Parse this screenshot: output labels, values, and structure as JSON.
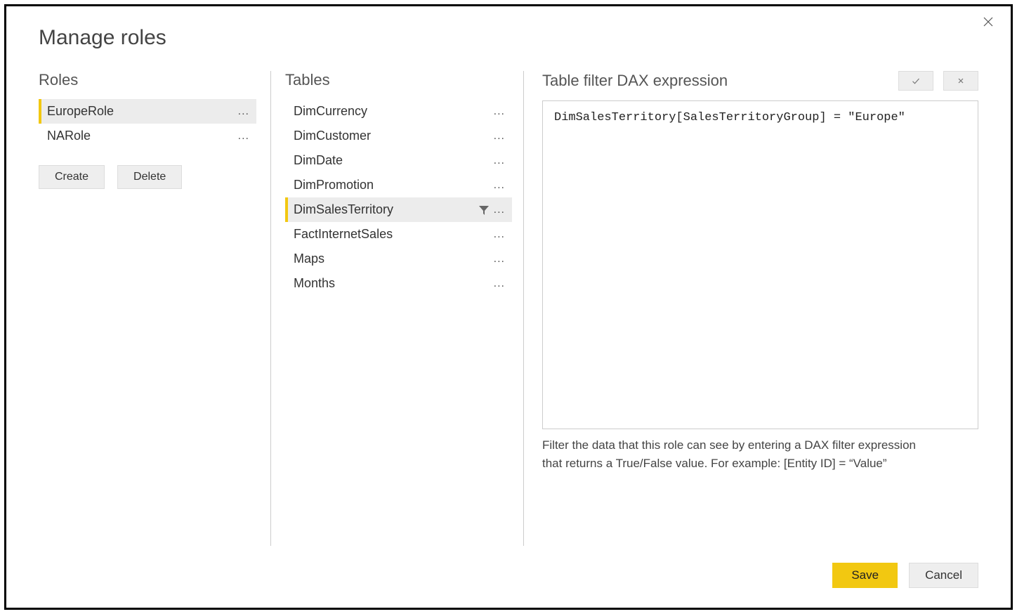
{
  "dialog": {
    "title": "Manage roles"
  },
  "roles": {
    "title": "Roles",
    "items": [
      {
        "name": "EuropeRole",
        "selected": true
      },
      {
        "name": "NARole",
        "selected": false
      }
    ],
    "create_label": "Create",
    "delete_label": "Delete"
  },
  "tables": {
    "title": "Tables",
    "items": [
      {
        "name": "DimCurrency",
        "selected": false,
        "has_filter": false
      },
      {
        "name": "DimCustomer",
        "selected": false,
        "has_filter": false
      },
      {
        "name": "DimDate",
        "selected": false,
        "has_filter": false
      },
      {
        "name": "DimPromotion",
        "selected": false,
        "has_filter": false
      },
      {
        "name": "DimSalesTerritory",
        "selected": true,
        "has_filter": true
      },
      {
        "name": "FactInternetSales",
        "selected": false,
        "has_filter": false
      },
      {
        "name": "Maps",
        "selected": false,
        "has_filter": false
      },
      {
        "name": "Months",
        "selected": false,
        "has_filter": false
      }
    ]
  },
  "dax": {
    "title": "Table filter DAX expression",
    "expression": "DimSalesTerritory[SalesTerritoryGroup] = \"Europe\"",
    "hint": "Filter the data that this role can see by entering a DAX filter expression that returns a True/False value. For example: [Entity ID] = “Value”"
  },
  "footer": {
    "save_label": "Save",
    "cancel_label": "Cancel"
  },
  "glyphs": {
    "ellipsis": "..."
  }
}
